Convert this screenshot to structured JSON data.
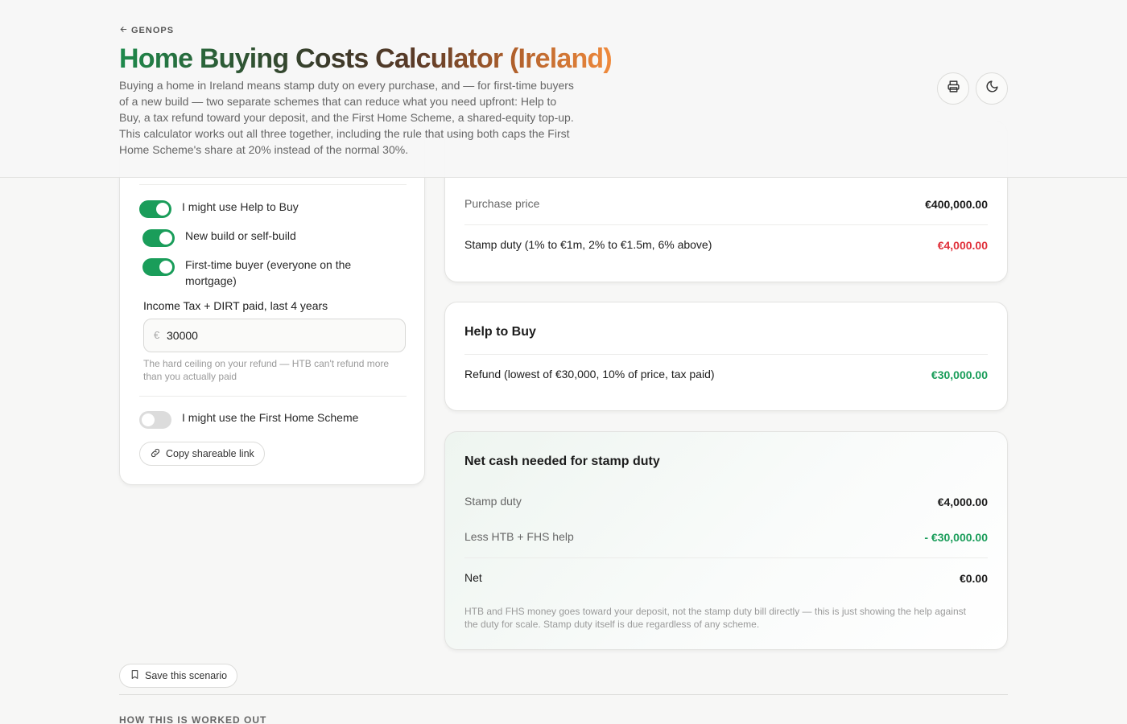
{
  "header": {
    "back_label": "GENOPS",
    "title": "Home Buying Costs Calculator (Ireland)",
    "intro": "Buying a home in Ireland means stamp duty on every purchase, and — for first-time buyers of a new build — two separate schemes that can reduce what you need upfront: Help to Buy, a tax refund toward your deposit, and the First Home Scheme, a shared-equity top-up. This calculator works out all three together, including the rule that using both caps the First Home Scheme's share at 20% instead of the normal 30%."
  },
  "inputs": {
    "htb_toggle": {
      "label": "I might use Help to Buy",
      "on": true
    },
    "new_build_toggle": {
      "label": "New build or self-build",
      "on": true
    },
    "ftb_toggle": {
      "label": "First-time buyer (everyone on the mortgage)",
      "on": true
    },
    "tax_paid": {
      "label": "Income Tax + DIRT paid, last 4 years",
      "currency": "€",
      "value": "30000",
      "hint": "The hard ceiling on your refund — HTB can't refund more than you actually paid"
    },
    "fhs_toggle": {
      "label": "I might use the First Home Scheme",
      "on": false
    },
    "share_label": "Copy shareable link"
  },
  "stamp_card": {
    "rows": [
      {
        "label": "Purchase price",
        "value": "€400,000.00"
      },
      {
        "label": "Stamp duty (1% to €1m, 2% to €1.5m, 6% above)",
        "value": "€4,000.00"
      }
    ]
  },
  "htb_card": {
    "title": "Help to Buy",
    "rows": [
      {
        "label": "Refund (lowest of €30,000, 10% of price, tax paid)",
        "value": "€30,000.00"
      }
    ]
  },
  "net_card": {
    "title": "Net cash needed for stamp duty",
    "rows": [
      {
        "label": "Stamp duty",
        "value": "€4,000.00"
      },
      {
        "label": "Less HTB + FHS help",
        "value": "- €30,000.00"
      },
      {
        "label": "Net",
        "value": "€0.00"
      }
    ],
    "note": "HTB and FHS money goes toward your deposit, not the stamp duty bill directly — this is just showing the help against the duty for scale. Stamp duty itself is due regardless of any scheme."
  },
  "footer": {
    "save_label": "Save this scenario",
    "section_heading": "HOW THIS IS WORKED OUT"
  },
  "colors": {
    "accent_green": "#1a9d5a",
    "negative_red": "#e0303a",
    "title_gradient_end": "#f08a3c"
  }
}
